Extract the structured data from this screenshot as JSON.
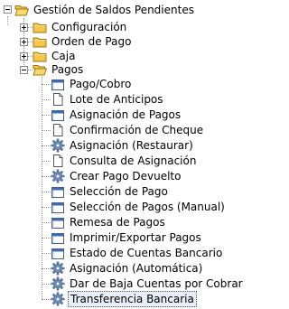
{
  "tree": {
    "root": {
      "label": "Gestión de Saldos Pendientes",
      "expanded": true,
      "icon": "folder-open-icon"
    },
    "folders": [
      {
        "label": "Configuración",
        "expanded": false,
        "icon": "folder-icon"
      },
      {
        "label": "Orden de Pago",
        "expanded": false,
        "icon": "folder-icon"
      },
      {
        "label": "Caja",
        "expanded": false,
        "icon": "folder-icon"
      },
      {
        "label": "Pagos",
        "expanded": true,
        "icon": "folder-open-icon"
      }
    ],
    "pagos_items": [
      {
        "label": "Pago/Cobro",
        "icon": "form-icon"
      },
      {
        "label": "Lote de Anticipos",
        "icon": "document-icon"
      },
      {
        "label": "Asignación de Pagos",
        "icon": "form-icon"
      },
      {
        "label": "Confirmación de Cheque",
        "icon": "document-icon"
      },
      {
        "label": "Asignación (Restaurar)",
        "icon": "gear-icon"
      },
      {
        "label": "Consulta de Asignación",
        "icon": "document-icon"
      },
      {
        "label": "Crear Pago Devuelto",
        "icon": "gear-icon"
      },
      {
        "label": "Selección de Pago",
        "icon": "form-icon"
      },
      {
        "label": "Selección de Pagos (Manual)",
        "icon": "form-icon"
      },
      {
        "label": "Remesa de Pagos",
        "icon": "form-icon"
      },
      {
        "label": "Imprimir/Exportar Pagos",
        "icon": "form-icon"
      },
      {
        "label": "Estado de Cuentas Bancario",
        "icon": "form-icon"
      },
      {
        "label": "Asignación (Automática)",
        "icon": "gear-icon"
      },
      {
        "label": "Dar de Baja Cuentas por Cobrar",
        "icon": "gear-icon"
      },
      {
        "label": "Transferencia Bancaria",
        "icon": "gear-icon",
        "selected": true
      }
    ]
  }
}
